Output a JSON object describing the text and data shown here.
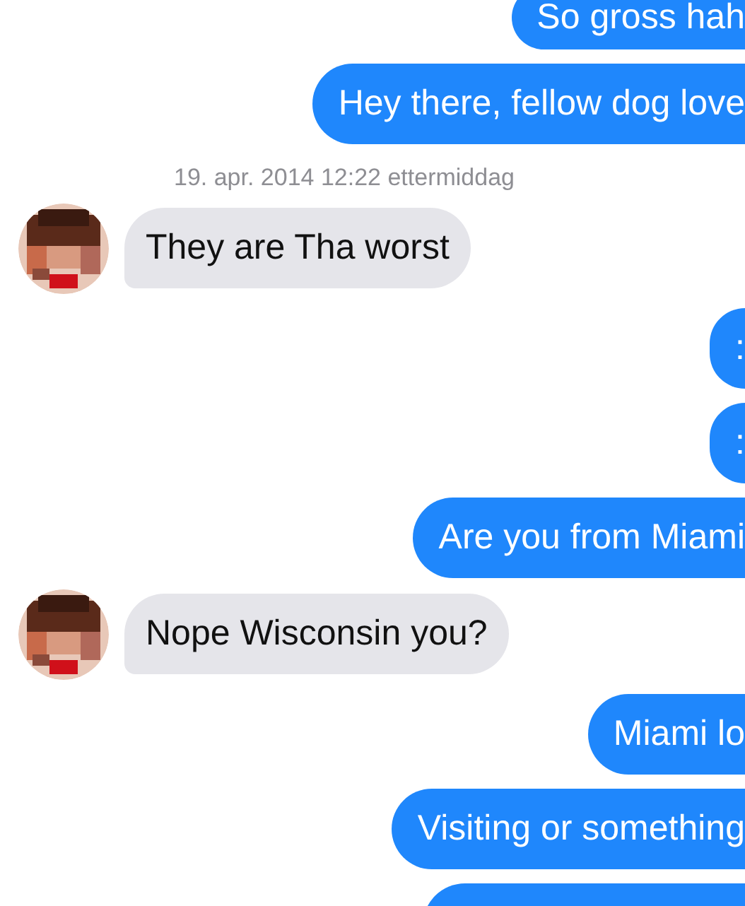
{
  "messages": [
    {
      "kind": "out",
      "text": "So gross hah"
    },
    {
      "kind": "out",
      "text": "Hey there, fellow dog love"
    },
    {
      "kind": "timestamp",
      "text": "19. apr. 2014 12:22 ettermiddag"
    },
    {
      "kind": "in",
      "text": "They are Tha worst"
    },
    {
      "kind": "out",
      "text": ":"
    },
    {
      "kind": "out",
      "text": ":"
    },
    {
      "kind": "out",
      "text": "Are you from Miami"
    },
    {
      "kind": "in",
      "text": "Nope Wisconsin you?"
    },
    {
      "kind": "out",
      "text": "Miami lo"
    },
    {
      "kind": "out",
      "text": "Visiting or something"
    },
    {
      "kind": "out_cut"
    }
  ]
}
